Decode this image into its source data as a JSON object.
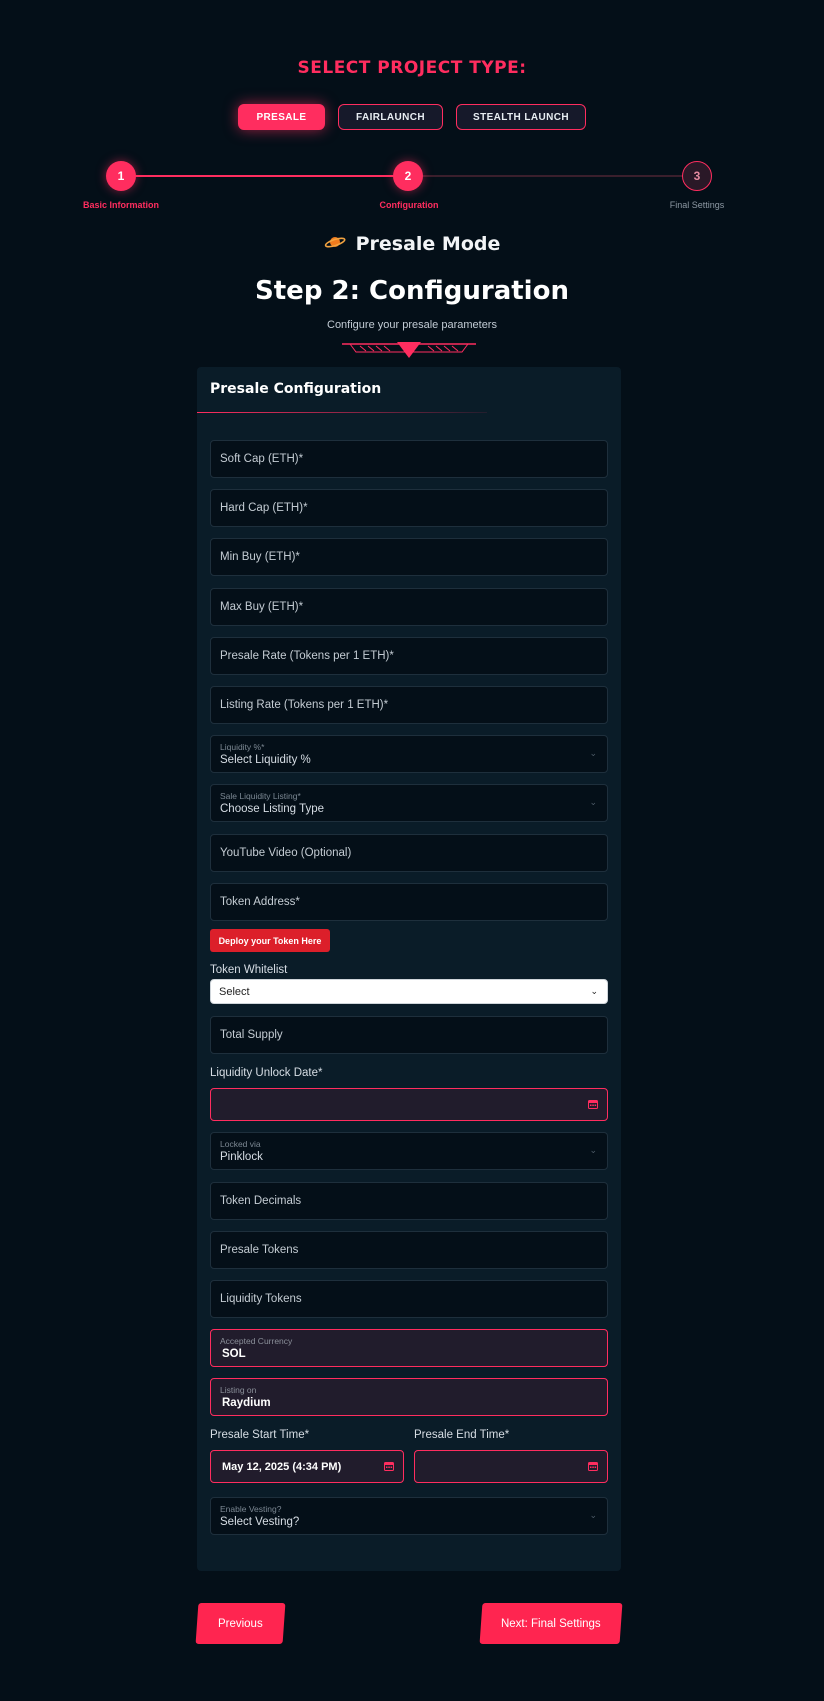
{
  "project_type": {
    "heading": "SELECT PROJECT TYPE:",
    "options": [
      {
        "label": "PRESALE",
        "active": true
      },
      {
        "label": "FAIRLAUNCH",
        "active": false
      },
      {
        "label": "STEALTH LAUNCH",
        "active": false
      }
    ]
  },
  "stepper": {
    "steps": [
      {
        "number": "1",
        "label": "Basic Information",
        "state": "done"
      },
      {
        "number": "2",
        "label": "Configuration",
        "state": "current"
      },
      {
        "number": "3",
        "label": "Final Settings",
        "state": "pending"
      }
    ]
  },
  "mode": {
    "icon": "planet-icon",
    "title": "Presale Mode"
  },
  "step_header": {
    "title": "Step 2: Configuration",
    "subtitle": "Configure your presale parameters"
  },
  "card": {
    "title": "Presale Configuration",
    "fields": {
      "soft_cap": "Soft Cap (ETH)*",
      "hard_cap": "Hard Cap (ETH)*",
      "min_buy": "Min Buy (ETH)*",
      "max_buy": "Max Buy (ETH)*",
      "presale_rate": "Presale Rate (Tokens per 1 ETH)*",
      "listing_rate": "Listing Rate (Tokens per 1 ETH)*",
      "liquidity": {
        "label": "Liquidity %*",
        "value": "Select Liquidity %"
      },
      "sale_listing": {
        "label": "Sale Liquidity Listing*",
        "value": "Choose Listing Type"
      },
      "youtube": "YouTube Video (Optional)",
      "token_address": "Token Address*",
      "deploy_button": "Deploy your Token Here",
      "whitelist": {
        "label": "Token Whitelist",
        "value": "Select"
      },
      "total_supply": "Total Supply",
      "unlock_date": {
        "label": "Liquidity Unlock Date*",
        "value": ""
      },
      "locked_via": {
        "label": "Locked via",
        "value": "Pinklock"
      },
      "token_decimals": "Token Decimals",
      "presale_tokens": "Presale Tokens",
      "liquidity_tokens": "Liquidity Tokens",
      "accepted_currency": {
        "label": "Accepted Currency",
        "value": "SOL"
      },
      "listing_on": {
        "label": "Listing on",
        "value": "Raydium"
      },
      "start_time": {
        "label": "Presale Start Time*",
        "value": "May 12, 2025 (4:34 PM)"
      },
      "end_time": {
        "label": "Presale End Time*",
        "value": ""
      },
      "vesting": {
        "label": "Enable Vesting?",
        "value": "Select Vesting?"
      }
    }
  },
  "navigation": {
    "previous": "Previous",
    "next": "Next: Final Settings"
  },
  "colors": {
    "accent": "#ff2d5f",
    "background": "#040f18",
    "card": "#0a1c28",
    "deploy": "#dc1f2a"
  }
}
